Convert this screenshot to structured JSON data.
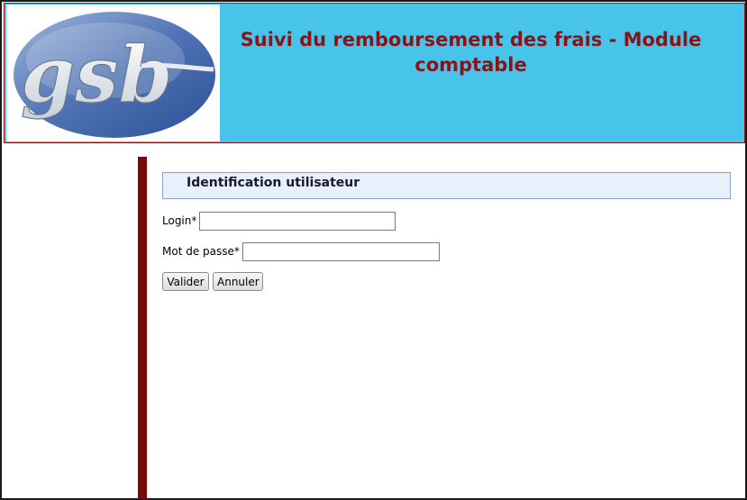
{
  "header": {
    "title_line1": "Suivi du remboursement des frais - Module",
    "title_line2": "comptable",
    "logo_text": "gsb",
    "colors": {
      "banner": "#48c4eb",
      "title": "#8b1216",
      "sidebar_bar": "#7a0a0a"
    }
  },
  "form": {
    "heading": "Identification utilisateur",
    "login_label": "Login*",
    "login_value": "",
    "password_label": "Mot de passe*",
    "password_value": "",
    "submit_label": "Valider",
    "reset_label": "Annuler"
  }
}
